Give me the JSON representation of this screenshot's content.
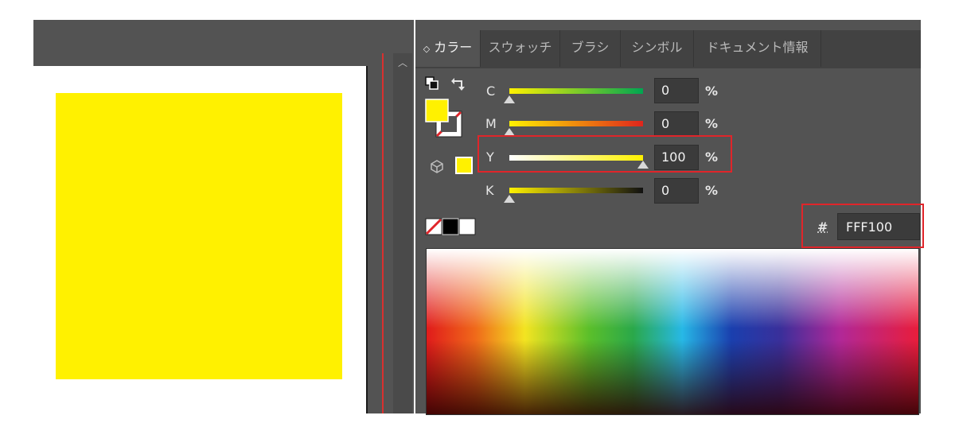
{
  "panel": {
    "tabs": [
      {
        "label": "カラー",
        "active": true,
        "prefix": "◇"
      },
      {
        "label": "スウォッチ",
        "active": false
      },
      {
        "label": "ブラシ",
        "active": false
      },
      {
        "label": "シンボル",
        "active": false
      },
      {
        "label": "ドキュメント情報",
        "active": false
      }
    ]
  },
  "sliders": [
    {
      "label": "C",
      "value": "0",
      "unit": "%",
      "level": 0
    },
    {
      "label": "M",
      "value": "0",
      "unit": "%",
      "level": 0
    },
    {
      "label": "Y",
      "value": "100",
      "unit": "%",
      "level": 100
    },
    {
      "label": "K",
      "value": "0",
      "unit": "%",
      "level": 0
    }
  ],
  "hex": {
    "symbol": "#",
    "value": "FFF100"
  },
  "colors": {
    "fill": "#fff100",
    "highlight_border": "#e0252a",
    "panel_bg": "#535353"
  },
  "icons": [
    "default-colors-icon",
    "swap-colors-icon",
    "fill-swatch-icon",
    "stroke-none-icon",
    "out-of-gamut-cube-icon",
    "none-swatch-icon",
    "black-swatch-icon",
    "white-swatch-icon",
    "scroll-up-icon"
  ]
}
